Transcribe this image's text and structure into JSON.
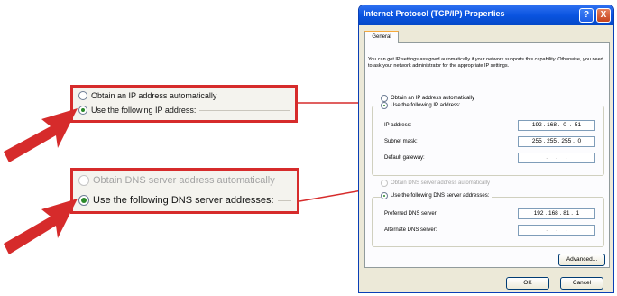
{
  "callouts": {
    "ip": {
      "option1": "Obtain an IP address automatically",
      "option2": "Use the following IP address:"
    },
    "dns": {
      "option1": "Obtain DNS server address automatically",
      "option2": "Use the following DNS server addresses:"
    }
  },
  "dialog": {
    "title": "Internet Protocol (TCP/IP) Properties",
    "help_glyph": "?",
    "close_glyph": "X",
    "tab_general": "General",
    "intro": "You can get IP settings assigned automatically if your network supports this capability. Otherwise, you need to ask your network administrator for the appropriate IP settings.",
    "ip": {
      "auto_label": "Obtain an IP address automatically",
      "manual_label": "Use the following IP address:",
      "ip_address_label": "IP address:",
      "ip_address_value": "192 . 168 .  0  .  51",
      "subnet_label": "Subnet mask:",
      "subnet_value": "255 . 255 . 255 .  0",
      "gateway_label": "Default gateway:",
      "gateway_value": ".     .     ."
    },
    "dns": {
      "auto_label": "Obtain DNS server address automatically",
      "manual_label": "Use the following DNS server addresses:",
      "preferred_label": "Preferred DNS server:",
      "preferred_value": "192 . 168 . 81 .  1",
      "alternate_label": "Alternate DNS server:",
      "alternate_value": ".     .     ."
    },
    "advanced_label": "Advanced...",
    "ok_label": "OK",
    "cancel_label": "Cancel"
  },
  "colors": {
    "arrow": "#d62b2b",
    "titlebar": "#0a54e0",
    "dialog_bg": "#ece9d8",
    "radio_selected": "#2a8a2a"
  }
}
